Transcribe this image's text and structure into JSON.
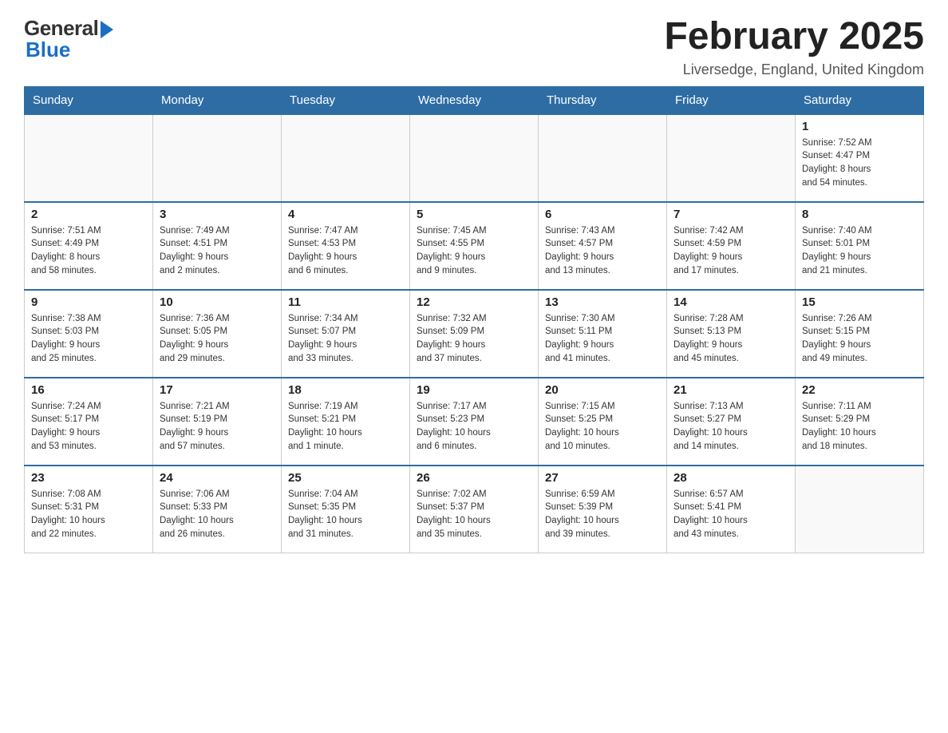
{
  "header": {
    "logo_general": "General",
    "logo_blue": "Blue",
    "month_title": "February 2025",
    "location": "Liversedge, England, United Kingdom"
  },
  "weekdays": [
    "Sunday",
    "Monday",
    "Tuesday",
    "Wednesday",
    "Thursday",
    "Friday",
    "Saturday"
  ],
  "weeks": [
    {
      "days": [
        {
          "number": "",
          "info": ""
        },
        {
          "number": "",
          "info": ""
        },
        {
          "number": "",
          "info": ""
        },
        {
          "number": "",
          "info": ""
        },
        {
          "number": "",
          "info": ""
        },
        {
          "number": "",
          "info": ""
        },
        {
          "number": "1",
          "info": "Sunrise: 7:52 AM\nSunset: 4:47 PM\nDaylight: 8 hours\nand 54 minutes."
        }
      ]
    },
    {
      "days": [
        {
          "number": "2",
          "info": "Sunrise: 7:51 AM\nSunset: 4:49 PM\nDaylight: 8 hours\nand 58 minutes."
        },
        {
          "number": "3",
          "info": "Sunrise: 7:49 AM\nSunset: 4:51 PM\nDaylight: 9 hours\nand 2 minutes."
        },
        {
          "number": "4",
          "info": "Sunrise: 7:47 AM\nSunset: 4:53 PM\nDaylight: 9 hours\nand 6 minutes."
        },
        {
          "number": "5",
          "info": "Sunrise: 7:45 AM\nSunset: 4:55 PM\nDaylight: 9 hours\nand 9 minutes."
        },
        {
          "number": "6",
          "info": "Sunrise: 7:43 AM\nSunset: 4:57 PM\nDaylight: 9 hours\nand 13 minutes."
        },
        {
          "number": "7",
          "info": "Sunrise: 7:42 AM\nSunset: 4:59 PM\nDaylight: 9 hours\nand 17 minutes."
        },
        {
          "number": "8",
          "info": "Sunrise: 7:40 AM\nSunset: 5:01 PM\nDaylight: 9 hours\nand 21 minutes."
        }
      ]
    },
    {
      "days": [
        {
          "number": "9",
          "info": "Sunrise: 7:38 AM\nSunset: 5:03 PM\nDaylight: 9 hours\nand 25 minutes."
        },
        {
          "number": "10",
          "info": "Sunrise: 7:36 AM\nSunset: 5:05 PM\nDaylight: 9 hours\nand 29 minutes."
        },
        {
          "number": "11",
          "info": "Sunrise: 7:34 AM\nSunset: 5:07 PM\nDaylight: 9 hours\nand 33 minutes."
        },
        {
          "number": "12",
          "info": "Sunrise: 7:32 AM\nSunset: 5:09 PM\nDaylight: 9 hours\nand 37 minutes."
        },
        {
          "number": "13",
          "info": "Sunrise: 7:30 AM\nSunset: 5:11 PM\nDaylight: 9 hours\nand 41 minutes."
        },
        {
          "number": "14",
          "info": "Sunrise: 7:28 AM\nSunset: 5:13 PM\nDaylight: 9 hours\nand 45 minutes."
        },
        {
          "number": "15",
          "info": "Sunrise: 7:26 AM\nSunset: 5:15 PM\nDaylight: 9 hours\nand 49 minutes."
        }
      ]
    },
    {
      "days": [
        {
          "number": "16",
          "info": "Sunrise: 7:24 AM\nSunset: 5:17 PM\nDaylight: 9 hours\nand 53 minutes."
        },
        {
          "number": "17",
          "info": "Sunrise: 7:21 AM\nSunset: 5:19 PM\nDaylight: 9 hours\nand 57 minutes."
        },
        {
          "number": "18",
          "info": "Sunrise: 7:19 AM\nSunset: 5:21 PM\nDaylight: 10 hours\nand 1 minute."
        },
        {
          "number": "19",
          "info": "Sunrise: 7:17 AM\nSunset: 5:23 PM\nDaylight: 10 hours\nand 6 minutes."
        },
        {
          "number": "20",
          "info": "Sunrise: 7:15 AM\nSunset: 5:25 PM\nDaylight: 10 hours\nand 10 minutes."
        },
        {
          "number": "21",
          "info": "Sunrise: 7:13 AM\nSunset: 5:27 PM\nDaylight: 10 hours\nand 14 minutes."
        },
        {
          "number": "22",
          "info": "Sunrise: 7:11 AM\nSunset: 5:29 PM\nDaylight: 10 hours\nand 18 minutes."
        }
      ]
    },
    {
      "days": [
        {
          "number": "23",
          "info": "Sunrise: 7:08 AM\nSunset: 5:31 PM\nDaylight: 10 hours\nand 22 minutes."
        },
        {
          "number": "24",
          "info": "Sunrise: 7:06 AM\nSunset: 5:33 PM\nDaylight: 10 hours\nand 26 minutes."
        },
        {
          "number": "25",
          "info": "Sunrise: 7:04 AM\nSunset: 5:35 PM\nDaylight: 10 hours\nand 31 minutes."
        },
        {
          "number": "26",
          "info": "Sunrise: 7:02 AM\nSunset: 5:37 PM\nDaylight: 10 hours\nand 35 minutes."
        },
        {
          "number": "27",
          "info": "Sunrise: 6:59 AM\nSunset: 5:39 PM\nDaylight: 10 hours\nand 39 minutes."
        },
        {
          "number": "28",
          "info": "Sunrise: 6:57 AM\nSunset: 5:41 PM\nDaylight: 10 hours\nand 43 minutes."
        },
        {
          "number": "",
          "info": ""
        }
      ]
    }
  ]
}
